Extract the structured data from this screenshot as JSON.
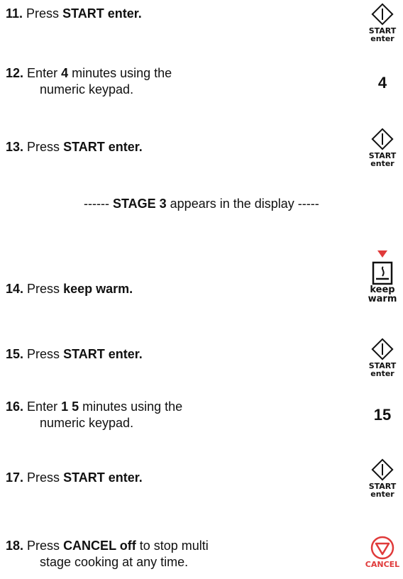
{
  "steps": [
    {
      "num": "11.",
      "pre": "Press ",
      "bold": "START enter.",
      "post": ""
    },
    {
      "num": "12.",
      "pre": "Enter ",
      "bold": "4",
      "post": " minutes using the",
      "line2": "numeric keypad."
    },
    {
      "num": "13.",
      "pre": "Press ",
      "bold": "START enter.",
      "post": ""
    },
    {
      "num": "14.",
      "pre": "Press ",
      "bold": "keep warm.",
      "post": ""
    },
    {
      "num": "15.",
      "pre": "Press ",
      "bold": "START enter.",
      "post": ""
    },
    {
      "num": "16.",
      "pre": "Enter ",
      "bold": "1 5",
      "post": " minutes using the",
      "line2": "numeric keypad."
    },
    {
      "num": "17.",
      "pre": "Press ",
      "bold": "START enter.",
      "post": ""
    },
    {
      "num": "18.",
      "pre": "Press ",
      "bold": "CANCEL off",
      "post": " to stop multi",
      "line2": "stage cooking at any time."
    }
  ],
  "divider": {
    "pre": "------ ",
    "bold": "STAGE 3",
    "post": " appears in the display -----"
  },
  "icons": {
    "start_label_1": "START",
    "start_label_2": "enter",
    "keep_warm_label_1": "keep",
    "keep_warm_label_2": "warm",
    "cancel_label": "CANCEL",
    "num_4": "4",
    "num_15": "15"
  },
  "colors": {
    "red": "#e03a3a",
    "text": "#111111"
  }
}
